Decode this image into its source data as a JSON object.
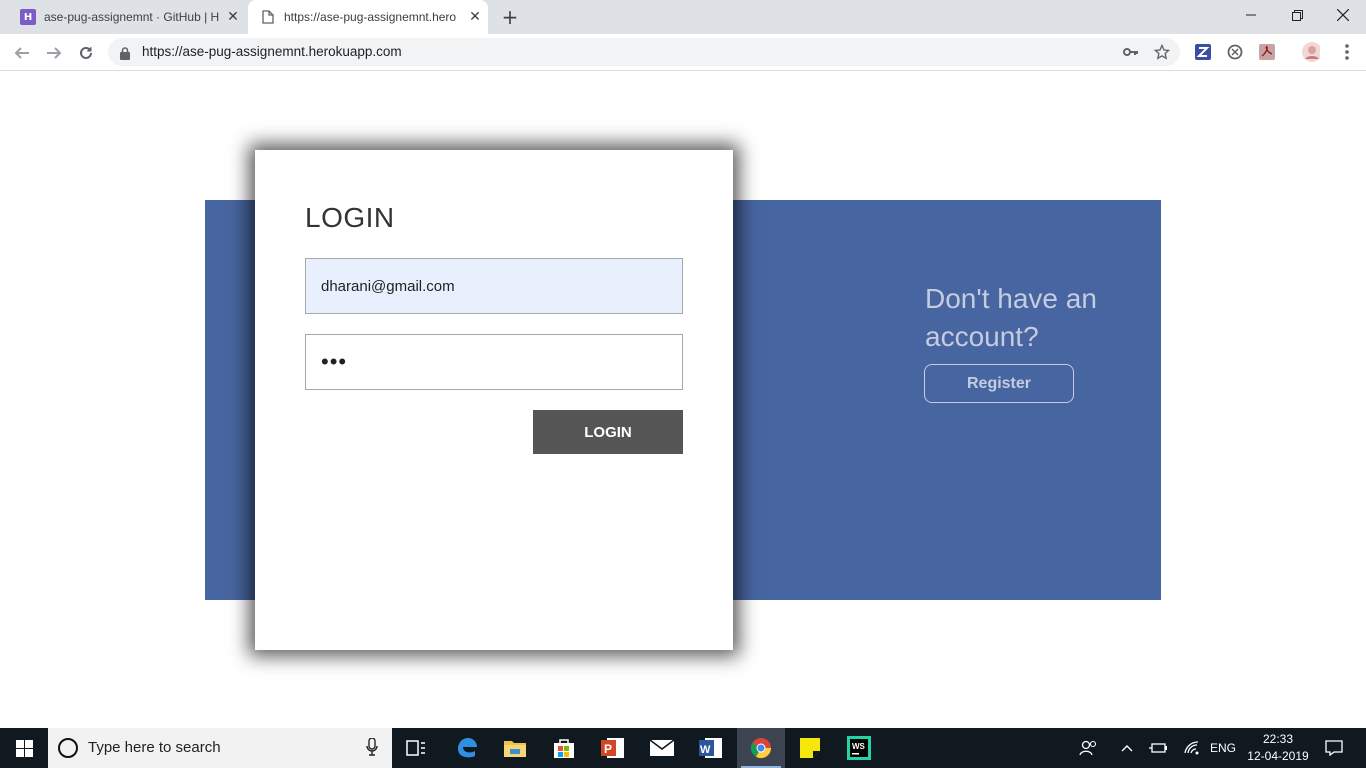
{
  "browser": {
    "tabs": [
      {
        "title": "ase-pug-assignemnt · GitHub | H",
        "favicon": "heroku-icon",
        "active": false
      },
      {
        "title": "https://ase-pug-assignemnt.hero",
        "favicon": "page-icon",
        "active": true
      }
    ],
    "url": "https://ase-pug-assignemnt.herokuapp.com"
  },
  "page": {
    "login_title": "LOGIN",
    "email_value": "dharani@gmail.com",
    "password_value": "•••",
    "login_button": "LOGIN",
    "side_heading": "Don't have an account?",
    "register_button": "Register",
    "colors": {
      "panel": "#4765a0",
      "button": "#555555",
      "autofill": "#e8f0fe"
    }
  },
  "taskbar": {
    "search_placeholder": "Type here to search",
    "language": "ENG",
    "time": "22:33",
    "date": "12-04-2019"
  }
}
